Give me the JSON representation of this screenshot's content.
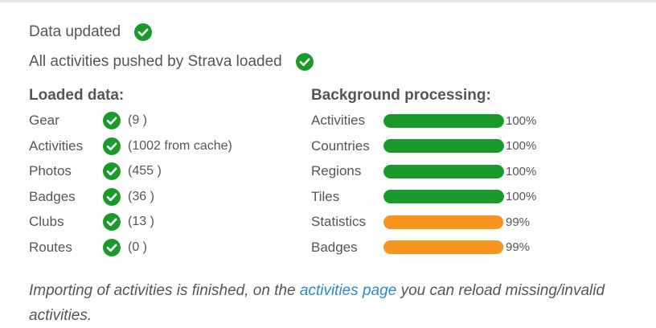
{
  "status": [
    {
      "text": "Data updated"
    },
    {
      "text": "All activities pushed by Strava loaded"
    }
  ],
  "loaded": {
    "title": "Loaded data:",
    "items": [
      {
        "label": "Gear",
        "count": "(9 )"
      },
      {
        "label": "Activities",
        "count": "(1002 from cache)"
      },
      {
        "label": "Photos",
        "count": "(455 )"
      },
      {
        "label": "Badges",
        "count": "(36 )"
      },
      {
        "label": "Clubs",
        "count": "(13 )"
      },
      {
        "label": "Routes",
        "count": "(0 )"
      }
    ]
  },
  "processing": {
    "title": "Background processing:",
    "items": [
      {
        "label": "Activities",
        "percent_text": "100%",
        "progress": 100,
        "status": "done"
      },
      {
        "label": "Countries",
        "percent_text": "100%",
        "progress": 100,
        "status": "done"
      },
      {
        "label": "Regions",
        "percent_text": "100%",
        "progress": 100,
        "status": "done"
      },
      {
        "label": "Tiles",
        "percent_text": "100%",
        "progress": 100,
        "status": "done"
      },
      {
        "label": "Statistics",
        "percent_text": "99%",
        "progress": 99,
        "status": "in-progress"
      },
      {
        "label": "Badges",
        "percent_text": "99%",
        "progress": 99,
        "status": "in-progress"
      }
    ]
  },
  "note": {
    "before": "Importing of activities is finished, on the ",
    "link": "activities page",
    "after": " you can reload missing/invalid activities."
  },
  "colors": {
    "success": "#1a9a2a",
    "done_bar": "#1a9a2a",
    "progress_bar": "#f7941d",
    "link": "#2a8bc9"
  },
  "icons": {
    "check": "check-circle-icon"
  }
}
